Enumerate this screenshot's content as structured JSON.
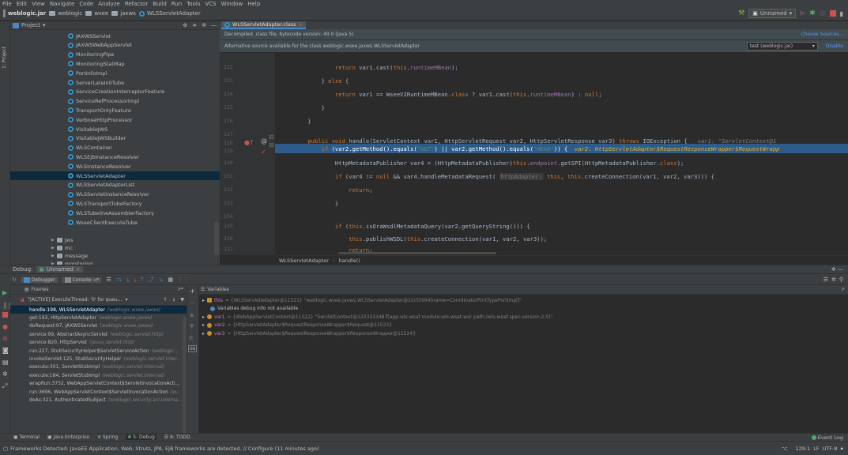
{
  "menu": [
    "File",
    "Edit",
    "View",
    "Navigate",
    "Code",
    "Analyze",
    "Refactor",
    "Build",
    "Run",
    "Tools",
    "VCS",
    "Window",
    "Help"
  ],
  "nav": {
    "crumbs": [
      "weblogic.jar",
      "weblogic",
      "wsee",
      "jaxws",
      "WLSServletAdapter"
    ],
    "run_config": "Unnamed"
  },
  "project": {
    "title": "Project",
    "classes": [
      "JAXWSServlet",
      "JAXWSWebAppServlet",
      "MonitoringPipe",
      "MonitoringStatMap",
      "PortInfoImpl",
      "ServerLateInitTube",
      "ServiceCreationInterceptorFeature",
      "ServiceRefProcessorImpl",
      "TransportOnlyFeature",
      "VerboseHttpProcessor",
      "VisitableJWS",
      "VisitableJWSBuilder",
      "WLSContainer",
      "WLSEjbInstanceResolver",
      "WLSInstanceResolver",
      "WLSServletAdapter",
      "WLSServletAdapterList",
      "WLSServletInstanceResolver",
      "WLSTransportTubeFactory",
      "WLSTubelineAssemblerFactory",
      "WseeClientExecuteTube"
    ],
    "selected_index": 15,
    "packages": [
      "jws",
      "mc",
      "message",
      "monitoring"
    ]
  },
  "editor": {
    "tab": "WLSServletAdapter.class",
    "banner_decompiled": "Decompiled .class file, bytecode version: 49.0 (Java 5)",
    "banner_choose": "Choose Sources...",
    "banner_alt": "Alternative source available for the class weblogic.wsee.jaxws.WLSServletAdapter",
    "alt_select": "test (weblogic.jar)",
    "banner_disable": "Disable",
    "line_numbers": [
      "122",
      "123",
      "124",
      "125",
      "126",
      "127",
      "128",
      "129",
      "130",
      "131",
      "132",
      "133",
      "134",
      "135",
      "136",
      "137"
    ],
    "current_line": "129",
    "breadcrumb": [
      "WLSServletAdapter",
      "handle()"
    ]
  },
  "debug": {
    "label": "Debug:",
    "session": "Unnamed",
    "tabs": [
      "Debugger",
      "Console"
    ],
    "frames_title": "Frames",
    "variables_title": "Variables",
    "thread": "\"[ACTIVE] ExecuteThread: '0' for queu...",
    "frames": [
      {
        "m": "handle:198, WLSServletAdapter",
        "p": "(weblogic.wsee.jaxws)"
      },
      {
        "m": "get:193, HttpServletAdapter",
        "p": "(weblogic.wsee.jaxws)"
      },
      {
        "m": "doRequest:97, JAXWSServlet",
        "p": "(weblogic.wsee.jaxws)"
      },
      {
        "m": "service:99, AbstractAsyncServlet",
        "p": "(weblogic.servlet.http)"
      },
      {
        "m": "service:820, HttpServlet",
        "p": "(javax.servlet.http)"
      },
      {
        "m": "run:227, StubSecurityHelper$ServletServiceAction",
        "p": "(weblogic..."
      },
      {
        "m": "invokeServlet:125, StubSecurityHelper",
        "p": "(weblogic.servlet.inter..."
      },
      {
        "m": "execute:301, ServletStubImpl",
        "p": "(weblogic.servlet.internal)"
      },
      {
        "m": "execute:184, ServletStubImpl",
        "p": "(weblogic.servlet.internal)"
      },
      {
        "m": "wrapRun:3732, WebAppServletContext$ServletInvocationActi...",
        "p": ""
      },
      {
        "m": "run:3696, WebAppServletContext$ServletInvocationAction",
        "p": "(w..."
      },
      {
        "m": "doAs:321, AuthenticatedSubject",
        "p": "(weblogic.security.acl.interna..."
      }
    ],
    "vars": [
      {
        "name": "this",
        "val": " = {WLSServletAdapter@11521} \"weblogic.wsee.jaxws.WLSServletAdapter@22cf2994[name=CoordinatorPortTypePortImpl]\""
      },
      {
        "name": "",
        "val": "Variables debug info not available"
      },
      {
        "name": "var1",
        "val": " = {WebAppServletContext@11522} \"ServletContext@1223223487[app:wls-wsat module:wls-wsat.war path:/wls-wsat spec-version:2.5]\""
      },
      {
        "name": "var2",
        "val": " = {HttpServletAdapter$RequestResponseWrapper$Request@11523}"
      },
      {
        "name": "var3",
        "val": " = {HttpServletAdapter$RequestResponseWrapper$ResponseWrapper@11524}"
      }
    ]
  },
  "bottom_tools": [
    "Terminal",
    "Java Enterprise",
    "Spring",
    "5: Debug",
    "6: TODO"
  ],
  "status": {
    "message": "Frameworks Detected: JavaEE Application, Web, Struts, JPA, EJB frameworks are detected. // Configure (11 minutes ago)",
    "event_log": "Event Log",
    "position": "129:1",
    "line_sep": "LF",
    "encoding": "UTF-8"
  },
  "colors": {
    "accent": "#4a88c7",
    "selection": "#0d293e",
    "exec_line": "#2d5b8a",
    "keyword": "#cc7832",
    "string": "#6a8759",
    "field": "#9876aa"
  }
}
